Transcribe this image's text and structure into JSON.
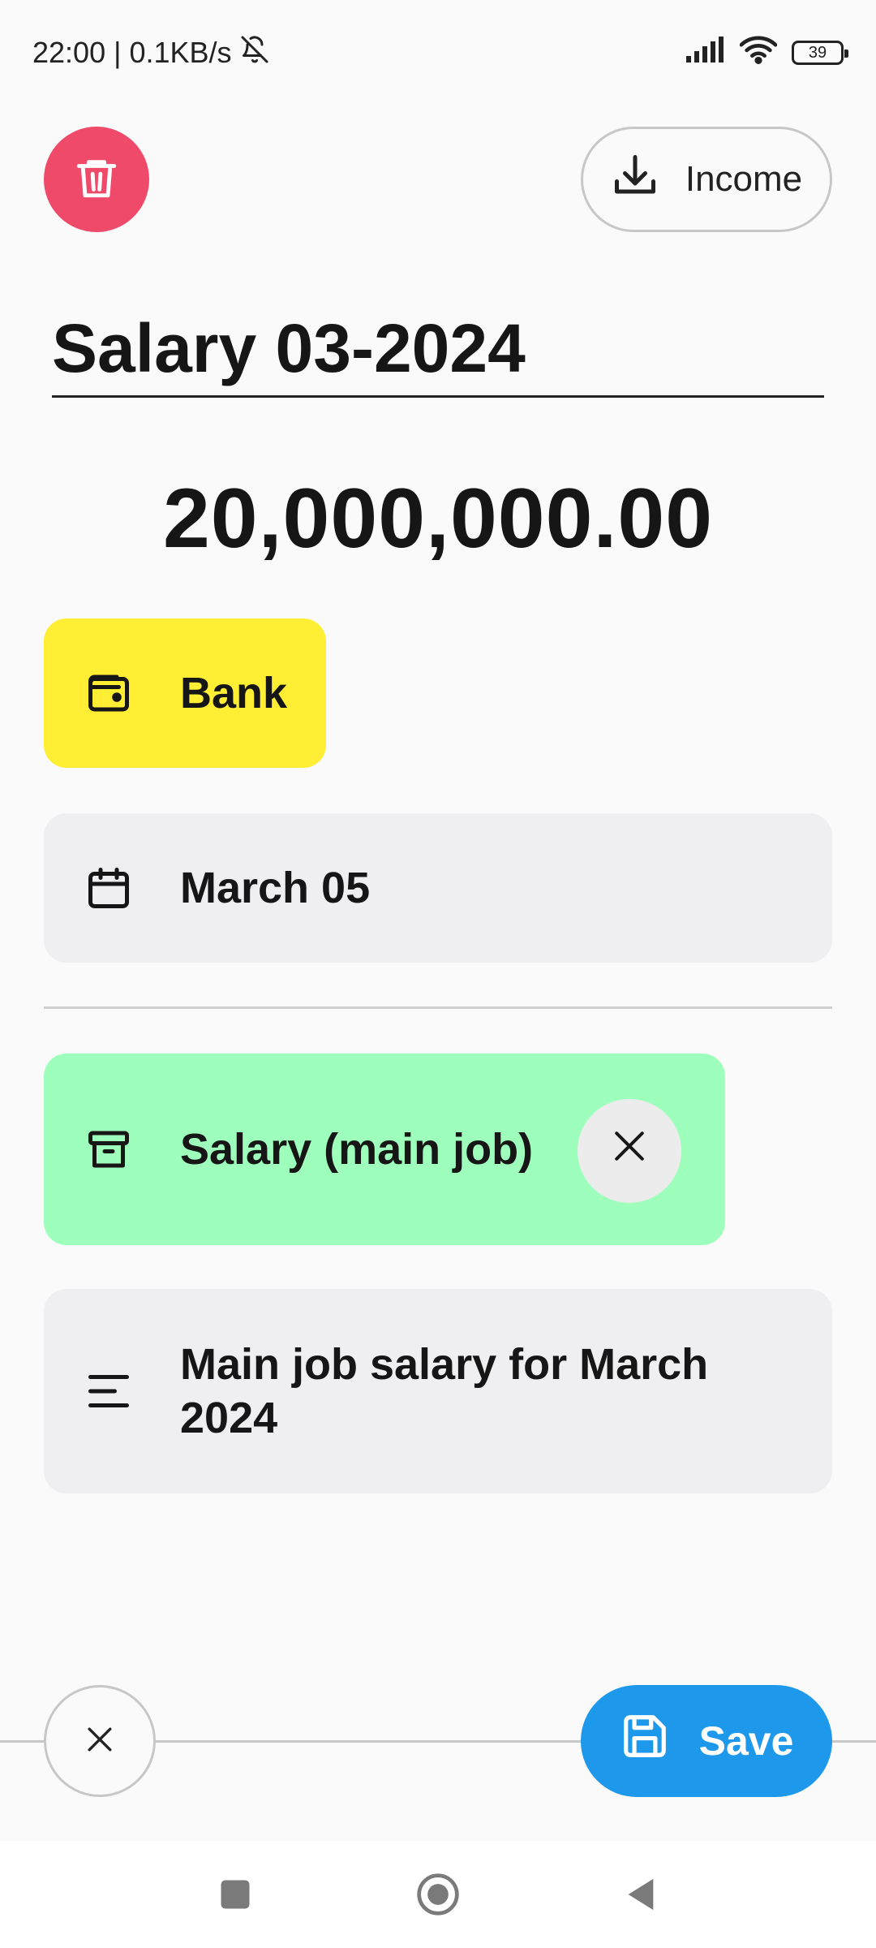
{
  "status_bar": {
    "time": "22:00",
    "separator": "|",
    "net_speed": "0.1KB/s",
    "battery": "39",
    "icons": [
      "mute-bell-icon",
      "signal-icon",
      "wifi-icon",
      "battery-icon"
    ]
  },
  "header": {
    "delete_icon": "trash-icon",
    "type_label": "Income",
    "type_icon": "download-icon"
  },
  "form": {
    "title": "Salary 03-2024",
    "amount": "20,000,000.00",
    "account": {
      "label": "Bank",
      "icon": "wallet-icon",
      "color": "#ffee33"
    },
    "date": {
      "label": "March 05",
      "icon": "calendar-icon"
    },
    "category": {
      "label": "Salary (main job)",
      "icon": "archive-box-icon",
      "color": "#9effbd",
      "clear_icon": "close-icon"
    },
    "note": {
      "label": "Main job salary for March 2024",
      "icon": "text-lines-icon"
    }
  },
  "footer": {
    "close_icon": "close-icon",
    "save_label": "Save",
    "save_icon": "floppy-disk-icon"
  },
  "colors": {
    "delete": "#f04a6b",
    "save": "#1e98ea",
    "background": "#fafafa",
    "chip_gray": "#efeff1"
  },
  "system_nav": [
    "recents-icon",
    "home-icon",
    "back-icon"
  ]
}
